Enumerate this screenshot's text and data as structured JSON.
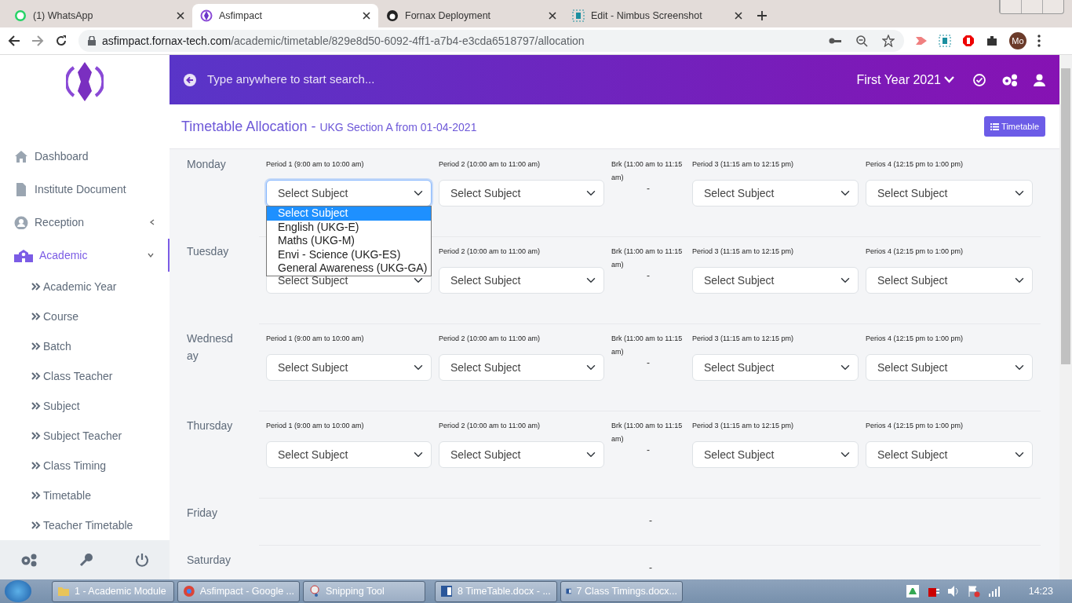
{
  "browser": {
    "tabs": [
      {
        "title": "(1) WhatsApp",
        "selected": false
      },
      {
        "title": "Asfimpact",
        "selected": true
      },
      {
        "title": "Fornax Deployment",
        "selected": false
      },
      {
        "title": "Edit - Nimbus Screenshot",
        "selected": false
      }
    ],
    "url_host": "asfimpact.fornax-tech.com",
    "url_path": "/academic/timetable/829e8d50-6092-4ff1-a7b4-e3cda6518797/allocation",
    "profile": "Mo"
  },
  "sidebar": {
    "items": [
      {
        "label": "Dashboard",
        "selected": false
      },
      {
        "label": "Institute Document",
        "selected": false
      },
      {
        "label": "Reception",
        "selected": false,
        "expanded": false
      },
      {
        "label": "Academic",
        "selected": true,
        "expanded": true,
        "children": [
          {
            "label": "Academic Year"
          },
          {
            "label": "Course"
          },
          {
            "label": "Batch"
          },
          {
            "label": "Class Teacher"
          },
          {
            "label": "Subject"
          },
          {
            "label": "Subject Teacher"
          },
          {
            "label": "Class Timing"
          },
          {
            "label": "Timetable"
          },
          {
            "label": "Teacher Timetable"
          }
        ]
      }
    ]
  },
  "header": {
    "search_placeholder": "Type anywhere to start search...",
    "year": "First Year 2021"
  },
  "page": {
    "title": "Timetable Allocation -",
    "subtitle": "UKG Section A from 01-04-2021",
    "button": "Timetable"
  },
  "days": [
    {
      "day": "Monday",
      "slots": [
        {
          "kind": "period",
          "label": "Period 1 (9:00 am to 10:00 am)",
          "value": "Select Subject",
          "open": true,
          "options": [
            {
              "label": "Select Subject",
              "selected": true
            },
            {
              "label": "English (UKG-E)",
              "selected": false
            },
            {
              "label": "Maths (UKG-M)",
              "selected": false
            },
            {
              "label": "Envi - Science (UKG-ES)",
              "selected": false
            },
            {
              "label": "General Awareness (UKG-GA)",
              "selected": false
            }
          ]
        },
        {
          "kind": "period",
          "label": "Period 2 (10:00 am to 11:00 am)",
          "value": "Select Subject"
        },
        {
          "kind": "break",
          "label": "Brk (11:00 am to 11:15 am)",
          "value": "-"
        },
        {
          "kind": "period",
          "label": "Period 3 (11:15 am to 12:15 pm)",
          "value": "Select Subject"
        },
        {
          "kind": "period",
          "label": "Perios 4 (12:15 pm to 1:00 pm)",
          "value": "Select Subject"
        }
      ]
    },
    {
      "day": "Tuesday",
      "slots": [
        {
          "kind": "period",
          "value": "Select Subject"
        },
        {
          "kind": "period",
          "label": "Period 2 (10:00 am to 11:00 am)",
          "value": "Select Subject"
        },
        {
          "kind": "break",
          "label": "Brk (11:00 am to 11:15 am)",
          "value": "-"
        },
        {
          "kind": "period",
          "label": "Period 3 (11:15 am to 12:15 pm)",
          "value": "Select Subject"
        },
        {
          "kind": "period",
          "label": "Perios 4 (12:15 pm to 1:00 pm)",
          "value": "Select Subject"
        }
      ]
    },
    {
      "day": "Wednesday",
      "slots": [
        {
          "kind": "period",
          "label": "Period 1 (9:00 am to 10:00 am)",
          "value": "Select Subject"
        },
        {
          "kind": "period",
          "label": "Period 2 (10:00 am to 11:00 am)",
          "value": "Select Subject"
        },
        {
          "kind": "break",
          "label": "Brk (11:00 am to 11:15 am)",
          "value": "-"
        },
        {
          "kind": "period",
          "label": "Period 3 (11:15 am to 12:15 pm)",
          "value": "Select Subject"
        },
        {
          "kind": "period",
          "label": "Perios 4 (12:15 pm to 1:00 pm)",
          "value": "Select Subject"
        }
      ]
    },
    {
      "day": "Thursday",
      "slots": [
        {
          "kind": "period",
          "label": "Period 1 (9:00 am to 10:00 am)",
          "value": "Select Subject"
        },
        {
          "kind": "period",
          "label": "Period 2 (10:00 am to 11:00 am)",
          "value": "Select Subject"
        },
        {
          "kind": "break",
          "label": "Brk (11:00 am to 11:15 am)",
          "value": "-"
        },
        {
          "kind": "period",
          "label": "Period 3 (11:15 am to 12:15 pm)",
          "value": "Select Subject"
        },
        {
          "kind": "period",
          "label": "Perios 4 (12:15 pm to 1:00 pm)",
          "value": "Select Subject"
        }
      ]
    },
    {
      "day": "Friday",
      "slots": [
        {
          "kind": "empty"
        },
        {
          "kind": "empty"
        },
        {
          "kind": "break",
          "value": "-"
        }
      ]
    },
    {
      "day": "Saturday",
      "slots": [
        {
          "kind": "empty"
        },
        {
          "kind": "empty"
        },
        {
          "kind": "break",
          "value": "-"
        }
      ]
    }
  ],
  "taskbar": {
    "items": [
      {
        "title": "1 - Academic Module"
      },
      {
        "title": "Asfimpact - Google ..."
      },
      {
        "title": "Snipping Tool"
      },
      {
        "title": "8 TimeTable.docx - ..."
      },
      {
        "title": "7 Class Timings.docx..."
      }
    ],
    "clock": "14:23"
  }
}
